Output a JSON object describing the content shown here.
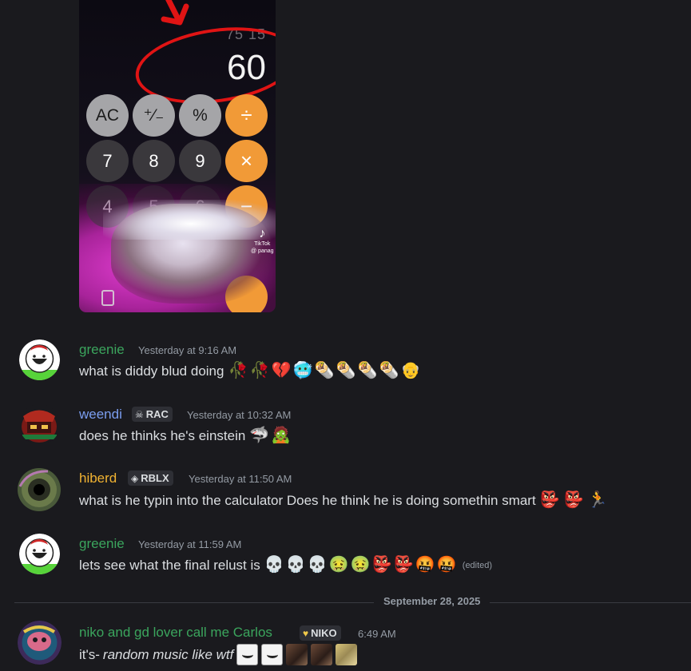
{
  "video": {
    "calc_top": "75 15",
    "calc_display": "60",
    "keys": [
      "AC",
      "⁺∕₋",
      "%",
      "÷",
      "7",
      "8",
      "9",
      "×",
      "4",
      "5",
      "6",
      "−"
    ],
    "watermark_brand": "TikTok",
    "watermark_user": "@ panag",
    "colors": {
      "annotation": "#e01414",
      "orange_key": "#f19a37"
    }
  },
  "messages": [
    {
      "username": "greenie",
      "name_color": "#3ba55d",
      "timestamp": "Yesterday at 9:16 AM",
      "text": "what is diddy blud doing",
      "emojis": [
        "🥀",
        "🥀",
        "💔",
        "🥶",
        "🌯",
        "🌯",
        "🌯",
        "🌯",
        "👴"
      ]
    },
    {
      "username": "weendi",
      "name_color": "#7b9ef0",
      "badge": "RAC",
      "badge_icon": "skull-icon",
      "timestamp": "Yesterday at 10:32 AM",
      "text": "does he thinks he's einstein",
      "emojis": [
        "🦈",
        "🧟"
      ]
    },
    {
      "username": "hiberd",
      "name_color": "#f0b232",
      "badge": "RBLX",
      "badge_icon": "roblox-icon",
      "timestamp": "Yesterday at 11:50 AM",
      "text": "what is he typin into the calculator Does he think he is doing somethin smart",
      "emojis": [
        "👺",
        "👺",
        "🏃"
      ]
    },
    {
      "username": "greenie",
      "name_color": "#3ba55d",
      "timestamp": "Yesterday at 11:59 AM",
      "text": "lets see what the final relust is",
      "emojis": [
        "💀",
        "💀",
        "💀",
        "🤢",
        "🤢",
        "👺",
        "👺",
        "🤬",
        "🤬"
      ],
      "edited": "(edited)"
    }
  ],
  "date_divider": "September 28, 2025",
  "last_message": {
    "username": "niko and gd lover call me Carlos",
    "name_color": "#3ba55d",
    "badge": "NIKO",
    "badge_icon": "heart-icon",
    "timestamp": "6:49 AM",
    "text_prefix": "it's-",
    "text_italic": "random music like wtf"
  }
}
